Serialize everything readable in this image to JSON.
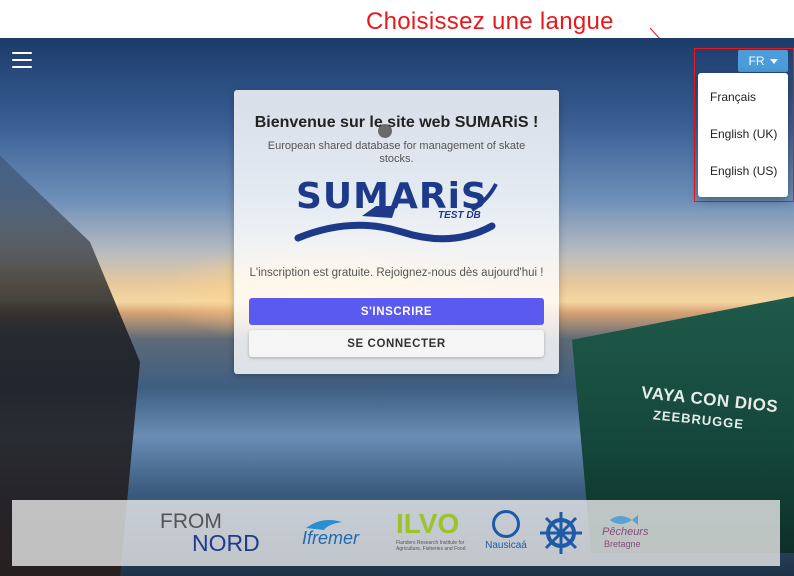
{
  "annotation": {
    "text": "Choisissez une langue",
    "color": "#e8191c"
  },
  "language": {
    "selected": "FR",
    "options": [
      "Français",
      "English (UK)",
      "English (US)"
    ]
  },
  "card": {
    "title": "Bienvenue sur le site web SUMARiS !",
    "subtitle": "European shared database for management of skate stocks.",
    "logo_text": "SUMARiS",
    "logo_sub": "TEST DB",
    "invite": "L'inscription est gratuite. Rejoignez-nous dès aujourd'hui !",
    "signup_label": "S'INSCRIRE",
    "login_label": "SE CONNECTER"
  },
  "background": {
    "boat_name": "VAYA CON DIOS",
    "boat_port": "ZEEBRUGGE"
  },
  "partners": {
    "fromnord_l1": "FROM",
    "fromnord_l2": "NORD",
    "ifremer": "Ifremer",
    "ilvo": "ILVO",
    "ilvo_tag": "Flanders Research Institute for Agriculture, Fisheries and Food",
    "nausicaa": "Nausicaá",
    "pecheurs_l1": "Pêcheurs",
    "pecheurs_l2": "Bretagne"
  },
  "colors": {
    "primary_button": "#5a5af0",
    "language_button": "#4b9cd8",
    "highlight": "#e8191c"
  },
  "icons": [
    "menu-icon",
    "caret-down-icon",
    "loading-spinner-icon"
  ]
}
